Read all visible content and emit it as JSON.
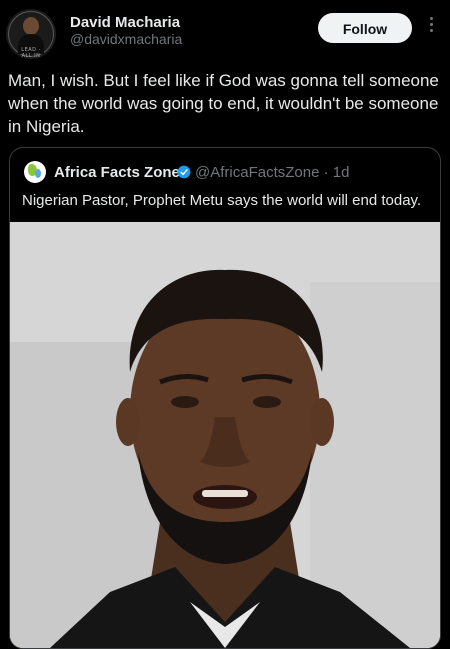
{
  "author": {
    "name": "David Macharia",
    "handle": "@davidxmacharia",
    "avatar_caption": "LEAD · ALL IN ONE"
  },
  "header": {
    "follow_label": "Follow",
    "more_icon": "more-vertical-icon"
  },
  "tweet": {
    "text": "Man, I wish. But I feel like if God was gonna tell someone when the world was going to end, it wouldn't be someone in Nigeria."
  },
  "quoted": {
    "name": "Africa Facts Zone",
    "verified": true,
    "handle": "@AfricaFactsZone",
    "time": "1d",
    "handle_time": "@AfricaFactsZone · 1d",
    "text": "Nigerian Pastor, Prophet Metu says the world will end today.",
    "media_subject": "man in suit speaking to camera in front of white wall"
  },
  "colors": {
    "background": "#000000",
    "text_primary": "#e7e9ea",
    "text_secondary": "#71767b",
    "verified_blue": "#1d9bf0",
    "border": "#3a3d40"
  }
}
